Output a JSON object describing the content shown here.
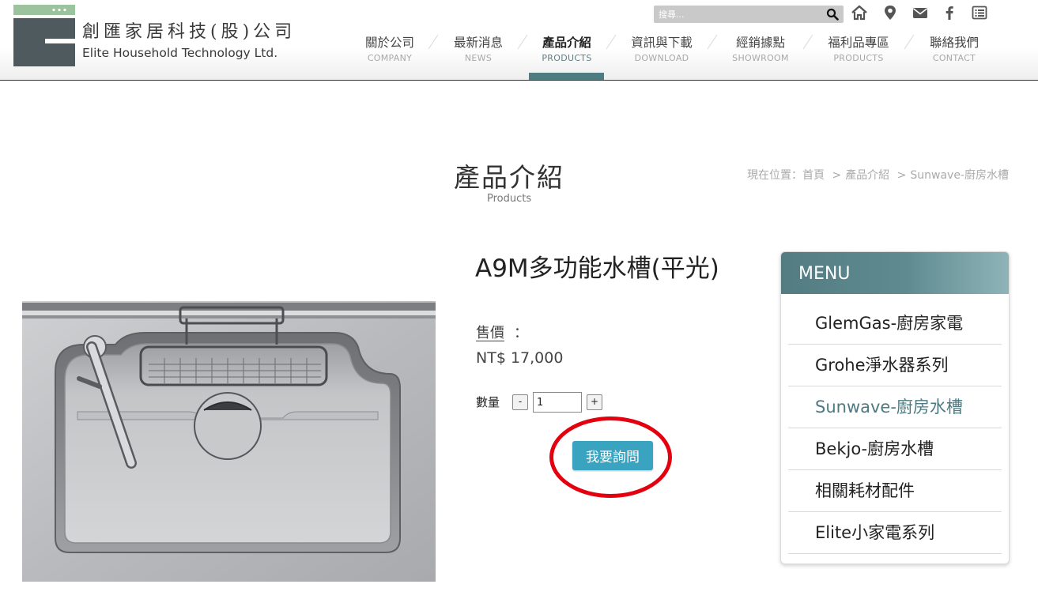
{
  "header": {
    "logo_cn": "創匯家居科技(股)公司",
    "logo_en": "Elite Household Technology Ltd.",
    "search_placeholder": "搜尋...",
    "nav": [
      {
        "cn": "關於公司",
        "en": "COMPANY"
      },
      {
        "cn": "最新消息",
        "en": "NEWS"
      },
      {
        "cn": "產品介紹",
        "en": "PRODUCTS",
        "active": true
      },
      {
        "cn": "資訊與下載",
        "en": "DOWNLOAD"
      },
      {
        "cn": "經銷據點",
        "en": "SHOWROOM"
      },
      {
        "cn": "福利品專區",
        "en": "PRODUCTS"
      },
      {
        "cn": "聯絡我們",
        "en": "CONTACT"
      }
    ],
    "icons": [
      "home-icon",
      "map-pin-icon",
      "envelope-icon",
      "facebook-icon",
      "list-icon"
    ]
  },
  "page": {
    "title": "產品介紹",
    "subtitle": "Products",
    "breadcrumb": {
      "prefix": "現在位置：",
      "items": [
        "首頁",
        "產品介紹",
        "Sunwave-廚房水槽"
      ],
      "separator": ">"
    }
  },
  "product": {
    "name": "A9M多功能水槽(平光)",
    "price_label": "售價",
    "price_colon": "：",
    "price": "NT$ 17,000",
    "qty_label": "數量",
    "qty_minus": "-",
    "qty_plus": "+",
    "qty_value": "1",
    "inquire_label": "我要詢問"
  },
  "menu": {
    "title": "MENU",
    "items": [
      {
        "label": "GlemGas-廚房家電"
      },
      {
        "label": "Grohe淨水器系列"
      },
      {
        "label": "Sunwave-廚房水槽",
        "active": true
      },
      {
        "label": "Bekjo-廚房水槽"
      },
      {
        "label": "相關耗材配件"
      },
      {
        "label": "Elite小家電系列"
      }
    ]
  },
  "colors": {
    "accent_teal": "#4f7c81",
    "button_blue": "#3aa3c0",
    "annotation_red": "#e3000f"
  }
}
